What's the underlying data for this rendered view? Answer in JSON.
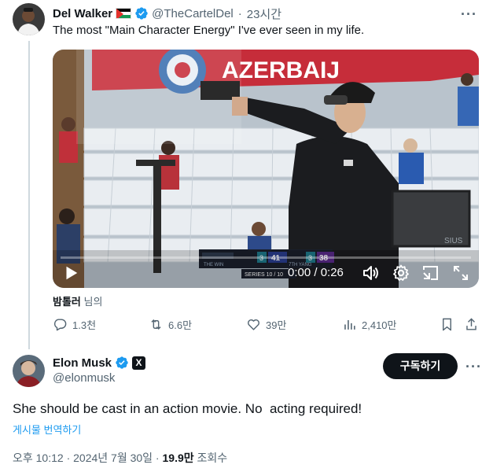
{
  "quoted_tweet": {
    "author_name": "Del Walker",
    "author_handle": "@TheCartelDel",
    "separator": "·",
    "time_ago": "23시간",
    "text": "The most \"Main Character Energy\" I've ever seen in my life.",
    "video": {
      "banner_text": "AZERBAIJ",
      "time_display": "0:00 / 0:26",
      "score_left": "41",
      "score_right": "38",
      "series_text": "SERIES 10 / 10",
      "brand": "SIUS",
      "left_team": "THE WIN",
      "right_team": "7TH YANG",
      "left_set": "3",
      "right_set": "3"
    },
    "caption_user": "밤톨러",
    "caption_suffix": "님의",
    "actions": {
      "replies": "1.3천",
      "reposts": "6.6만",
      "likes": "39만",
      "views": "2,410만"
    }
  },
  "main_tweet": {
    "author_name": "Elon Musk",
    "author_handle": "@elonmusk",
    "follow_label": "구독하기",
    "text": "She should be cast in an action movie. No  acting required!",
    "translate_label": "게시물 번역하기",
    "timestamp": "오후 10:12 · 2024년 7월 30일 · ",
    "views_count": "19.9만",
    "views_label": " 조회수"
  },
  "colors": {
    "accent": "#1d9bf0",
    "text_primary": "#0f1419",
    "text_secondary": "#536471"
  }
}
